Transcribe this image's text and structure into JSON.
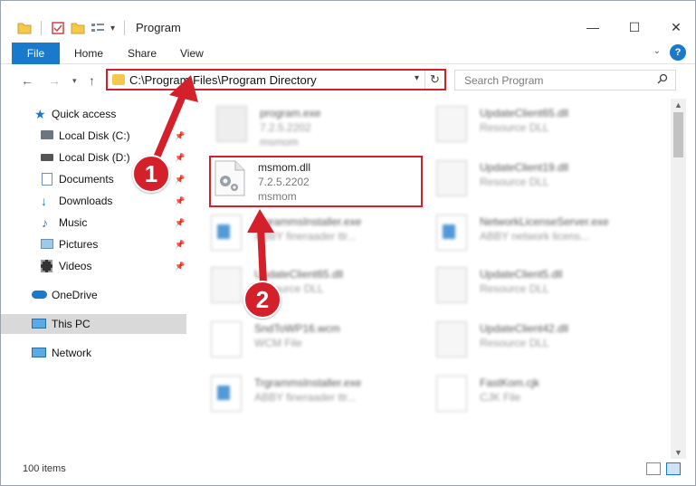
{
  "window": {
    "title": "Program",
    "controls": [
      "—",
      "☐",
      "✕"
    ]
  },
  "ribbon": {
    "file_tab": "File",
    "tabs": [
      "Home",
      "Share",
      "View"
    ],
    "help": "?"
  },
  "address_bar": {
    "path": "C:\\Program Files\\Program Directory"
  },
  "search": {
    "placeholder": "Search Program"
  },
  "sidebar": {
    "items": [
      {
        "label": "Quick access",
        "icon": "star-icon"
      },
      {
        "label": "Local Disk (C:)",
        "icon": "drive-icon",
        "pinned": true
      },
      {
        "label": "Local Disk (D:)",
        "icon": "drive-icon",
        "pinned": true
      },
      {
        "label": "Documents",
        "icon": "documents-icon",
        "pinned": true
      },
      {
        "label": "Downloads",
        "icon": "download-icon",
        "pinned": true
      },
      {
        "label": "Music",
        "icon": "music-icon",
        "pinned": true
      },
      {
        "label": "Pictures",
        "icon": "pictures-icon",
        "pinned": true
      },
      {
        "label": "Videos",
        "icon": "videos-icon",
        "pinned": true
      },
      {
        "label": "OneDrive",
        "icon": "cloud-icon"
      },
      {
        "label": "This PC",
        "icon": "computer-icon",
        "selected": true
      },
      {
        "label": "Network",
        "icon": "network-icon"
      }
    ]
  },
  "files": {
    "highlighted": {
      "name": "msmom.dll",
      "meta1": "7.2.5.2202",
      "meta2": "msmom"
    },
    "others": [
      {
        "name": "program.exe",
        "meta1": "7.2.5.2202",
        "meta2": "msmom"
      },
      {
        "name": "UpdateClient65.dll",
        "meta1": "Resource DLL"
      },
      {
        "name": "UpdateClient19.dll",
        "meta1": "Resource DLL"
      },
      {
        "name": "TrgrammsInstaller.exe",
        "meta1": "ABBY fineraader ttr..."
      },
      {
        "name": "NetworkLicenseServer.exe",
        "meta1": "ABBY network licens..."
      },
      {
        "name": "UpdateClient65.dll",
        "meta1": "Resource DLL"
      },
      {
        "name": "UpdateClient5.dll",
        "meta1": "Resource DLL"
      },
      {
        "name": "SndToWP16.wcm",
        "meta1": "WCM File"
      },
      {
        "name": "UpdateClient42.dll",
        "meta1": "Resource DLL"
      },
      {
        "name": "TrgrammsInstaller.exe",
        "meta1": "ABBY fineraader ttr..."
      },
      {
        "name": "FastKom.cjk",
        "meta1": "CJK File"
      }
    ]
  },
  "status_bar": {
    "item_count": "100 items"
  },
  "annotations": {
    "step1": "1",
    "step2": "2"
  },
  "colors": {
    "accent": "#1979ca",
    "highlight_red": "#d4202a",
    "selection": "#d9d9d9"
  }
}
